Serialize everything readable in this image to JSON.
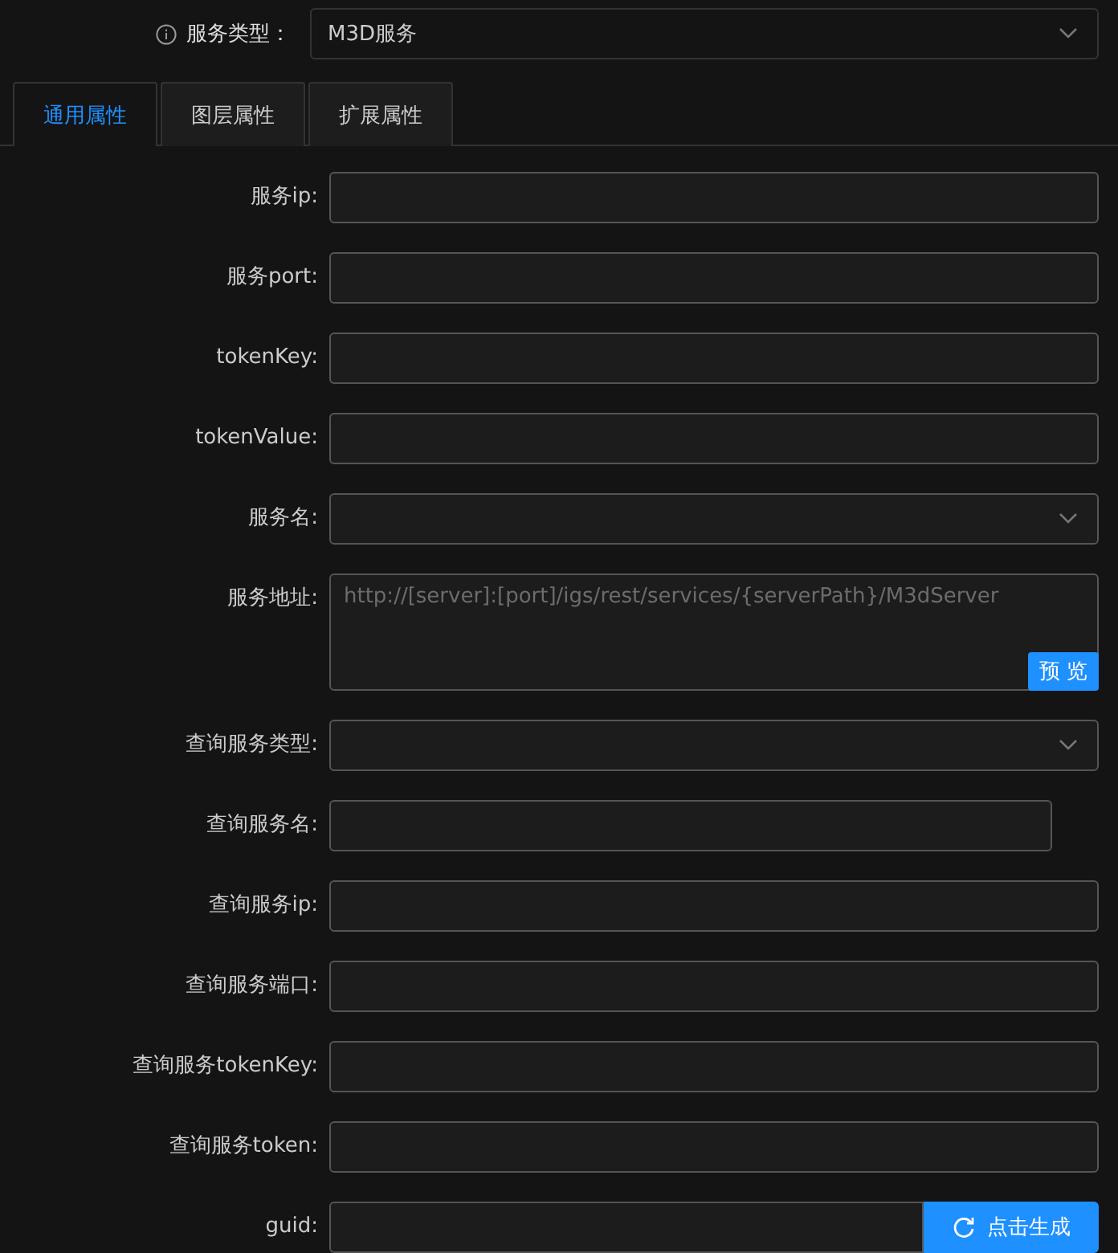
{
  "service_type": {
    "label": "服务类型：",
    "value": "M3D服务"
  },
  "tabs": [
    {
      "label": "通用属性",
      "selected": true
    },
    {
      "label": "图层属性",
      "selected": false
    },
    {
      "label": "扩展属性",
      "selected": false
    }
  ],
  "fields": [
    {
      "kind": "input",
      "label": "服务ip:"
    },
    {
      "kind": "input",
      "label": "服务port:"
    },
    {
      "kind": "input",
      "label": "tokenKey:"
    },
    {
      "kind": "input",
      "label": "tokenValue:"
    },
    {
      "kind": "select",
      "label": "服务名:"
    },
    {
      "kind": "textarea",
      "label": "服务地址:",
      "placeholder": "http://[server]:[port]/igs/rest/services/{serverPath}/M3dServer",
      "button": "预 览"
    },
    {
      "kind": "select",
      "label": "查询服务类型:"
    },
    {
      "kind": "narrow",
      "label": "查询服务名:"
    },
    {
      "kind": "input",
      "label": "查询服务ip:"
    },
    {
      "kind": "input",
      "label": "查询服务端口:"
    },
    {
      "kind": "input",
      "label": "查询服务tokenKey:"
    },
    {
      "kind": "input",
      "label": "查询服务token:"
    },
    {
      "kind": "guid",
      "label": "guid:",
      "button": "点击生成"
    }
  ]
}
